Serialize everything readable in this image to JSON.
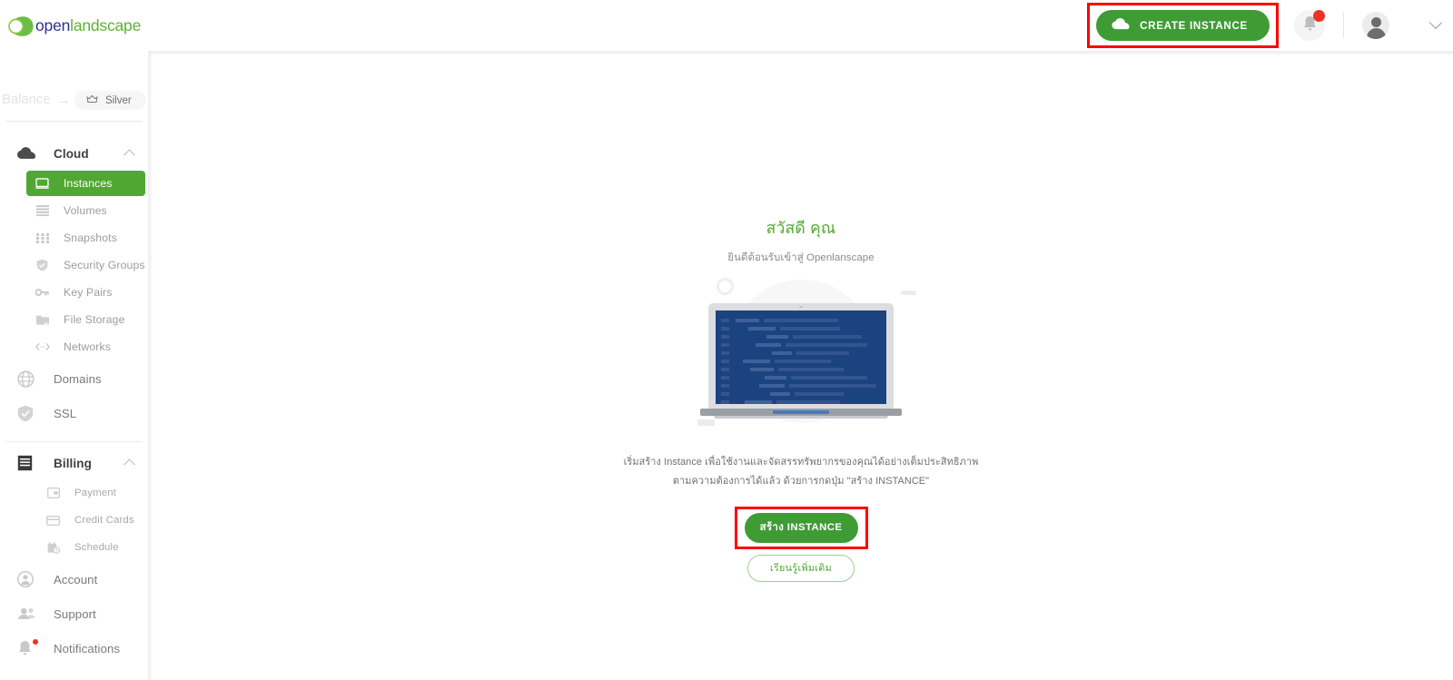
{
  "brand": {
    "logo_open": "open",
    "logo_landscape": "landscape",
    "accent_green": "#50a832",
    "brand_blue": "#2e3192",
    "highlight_red": "#ff0000"
  },
  "sidebar": {
    "balance": {
      "label": "Balance",
      "arrow": "→"
    },
    "tier": {
      "icon": "crown-icon",
      "label": "Silver"
    },
    "groups": [
      {
        "icon": "cloud-icon",
        "label": "Cloud",
        "expanded": true,
        "items": [
          {
            "icon": "monitor-icon",
            "label": "Instances",
            "active": true
          },
          {
            "icon": "layers-icon",
            "label": "Volumes",
            "active": false
          },
          {
            "icon": "grid-icon",
            "label": "Snapshots",
            "active": false
          },
          {
            "icon": "shield-icon",
            "label": "Security Groups",
            "active": false
          },
          {
            "icon": "key-icon",
            "label": "Key Pairs",
            "active": false
          },
          {
            "icon": "folder-icon",
            "label": "File Storage",
            "active": false
          },
          {
            "icon": "code-icon",
            "label": "Networks",
            "active": false
          }
        ]
      }
    ],
    "top_items": [
      {
        "icon": "globe-icon",
        "label": "Domains"
      },
      {
        "icon": "shield-check-icon",
        "label": "SSL"
      }
    ],
    "billing": {
      "icon": "receipt-icon",
      "label": "Billing",
      "expanded": true,
      "items": [
        {
          "icon": "wallet-icon",
          "label": "Payment"
        },
        {
          "icon": "credit-card-icon",
          "label": "Credit Cards"
        },
        {
          "icon": "calendar-clock-icon",
          "label": "Schedule"
        }
      ]
    },
    "bottom_items": [
      {
        "icon": "user-circle-icon",
        "label": "Account",
        "badge": false
      },
      {
        "icon": "people-icon",
        "label": "Support",
        "badge": false
      },
      {
        "icon": "bell-icon",
        "label": "Notifications",
        "badge": true
      }
    ]
  },
  "topbar": {
    "create_button": {
      "icon": "cloud-icon",
      "label": "CREATE INSTANCE",
      "highlighted": true
    },
    "bell": {
      "icon": "bell-icon",
      "has_badge": true
    },
    "avatar": {
      "icon": "avatar-icon"
    },
    "caret": {
      "icon": "chevron-down-icon"
    }
  },
  "main": {
    "title": "สวัสดี คุณ",
    "subtitle": "ยินดีต้อนรับเข้าสู่ Openlanscape",
    "description_line1": "เริ่มสร้าง Instance เพื่อใช้งานและจัดสรรทรัพยากรของคุณได้อย่างเต็มประสิทธิภาพ",
    "description_line2": "ตามความต้องการได้แล้ว ด้วยการกดปุ่ม \"สร้าง INSTANCE\"",
    "primary_button": "สร้าง INSTANCE",
    "secondary_button": "เรียนรู้เพิ่มเติม",
    "illustration": "laptop-with-code-illustration"
  }
}
